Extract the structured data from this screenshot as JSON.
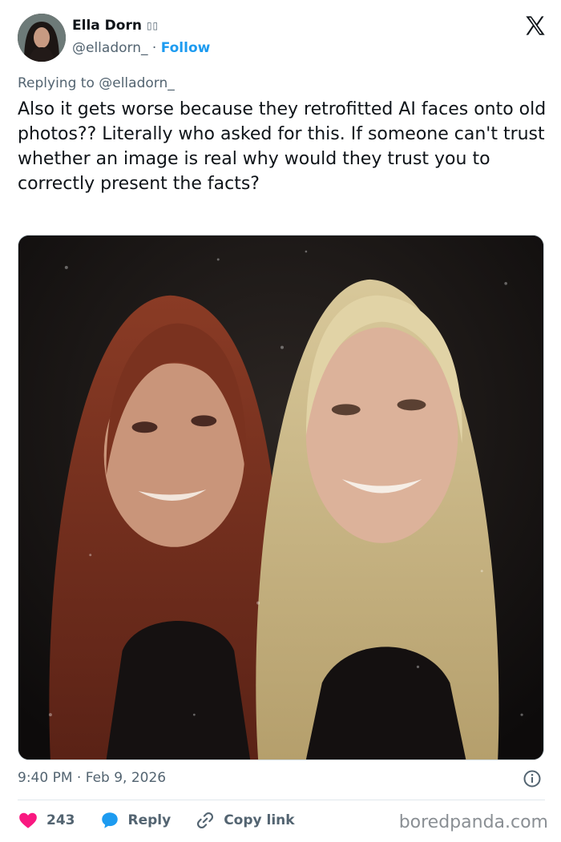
{
  "author": {
    "display_name": "Ella Dorn",
    "flag_glyphs": "▯▯",
    "handle": "@elladorn_",
    "separator": "·",
    "follow_label": "Follow"
  },
  "reply_context": {
    "prefix": "Replying to",
    "mention": "@elladorn_"
  },
  "tweet": {
    "text": "Also it gets worse because they retrofitted AI faces onto old photos?? Literally who asked for this. If someone can't trust whether an image is real why would they trust you to correctly present the facts?",
    "time": "9:40 PM",
    "date_separator": "·",
    "date": "Feb 9, 2026"
  },
  "actions": {
    "like_count": "243",
    "reply_label": "Reply",
    "copy_link_label": "Copy link"
  },
  "watermark": "boredpanda.com",
  "colors": {
    "like": "#f91880",
    "reply": "#1d9bf0",
    "follow": "#1d9bf0",
    "muted": "#536471"
  },
  "icons": {
    "logo": "x-logo-icon",
    "like": "heart-icon",
    "reply": "speech-bubble-icon",
    "copy": "link-icon",
    "info": "info-icon"
  }
}
